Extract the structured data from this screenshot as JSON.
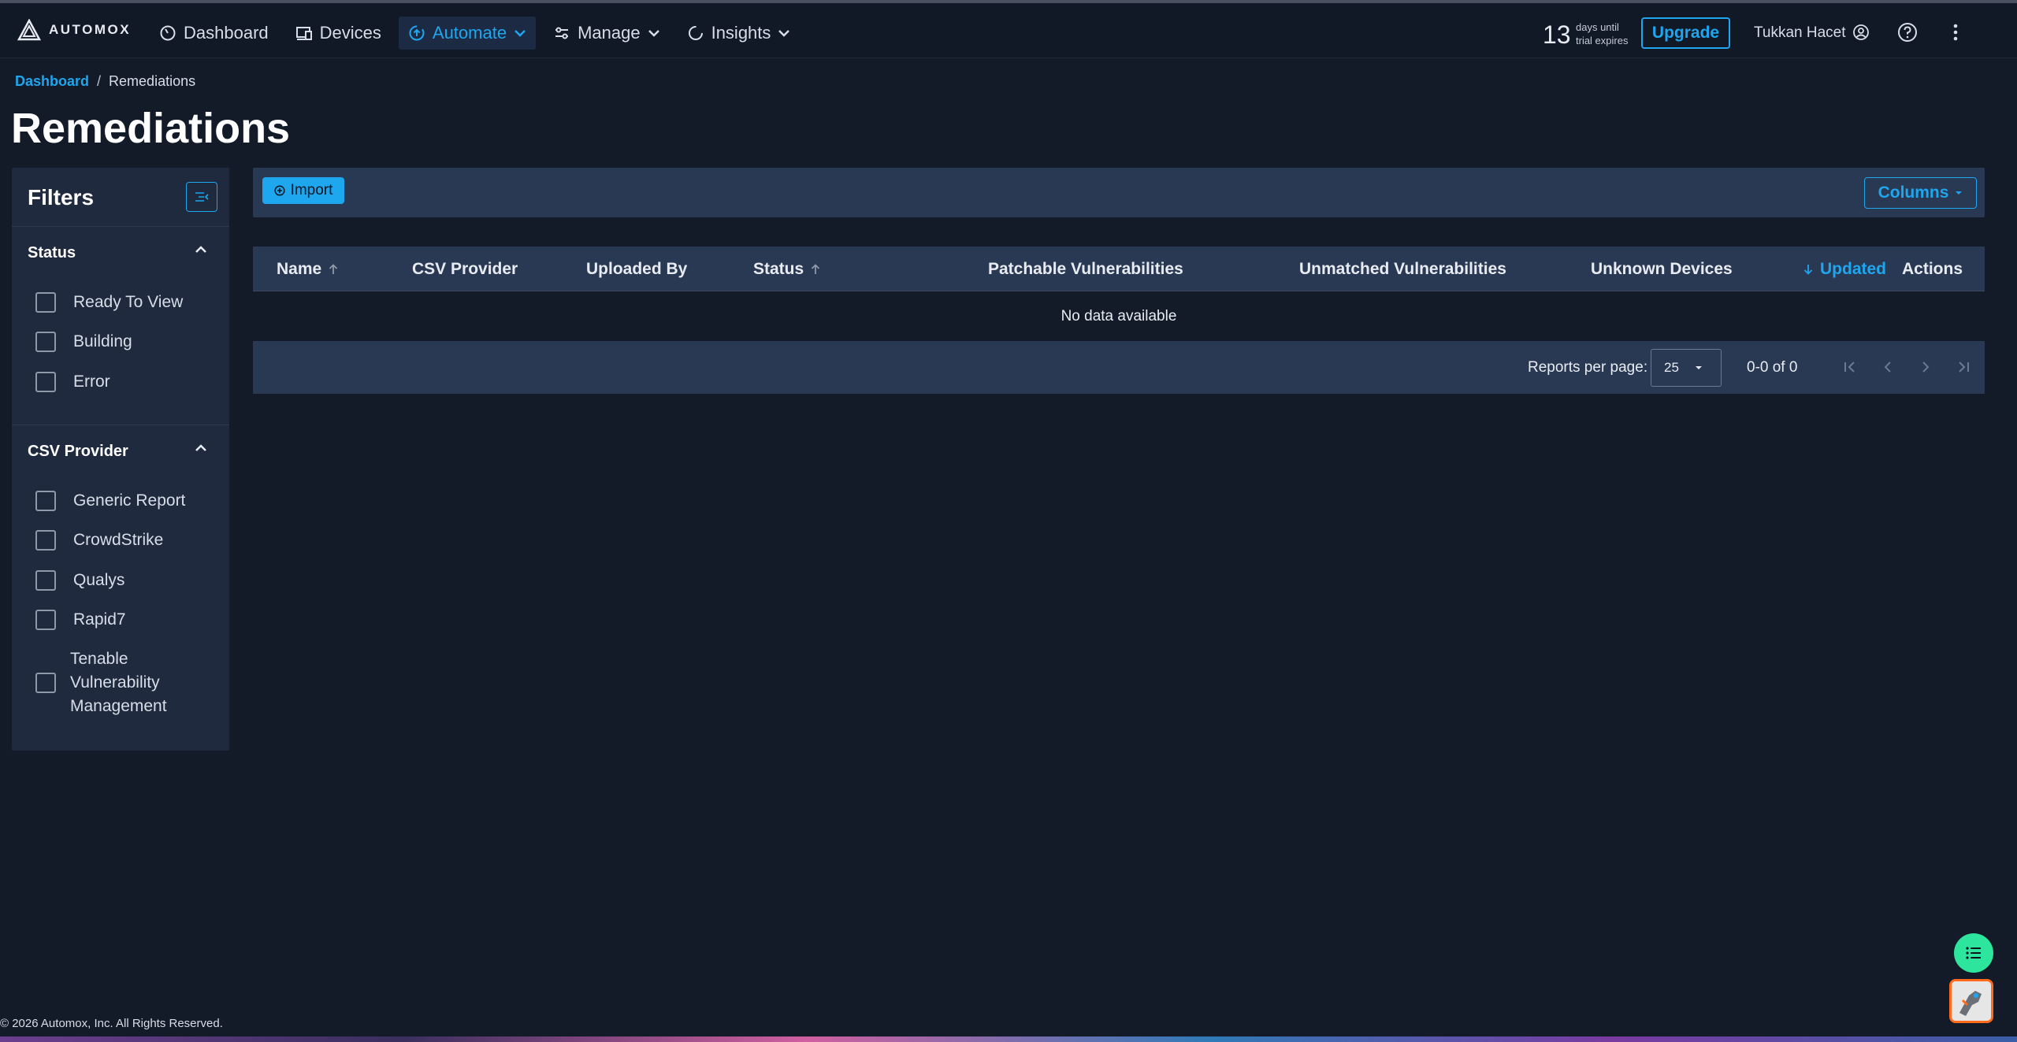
{
  "app": {
    "brand": "AUTOMOX",
    "accent_color": "#1ea6ee"
  },
  "nav": {
    "items": [
      {
        "label": "Dashboard",
        "icon": "gauge-icon"
      },
      {
        "label": "Devices",
        "icon": "devices-icon"
      },
      {
        "label": "Automate",
        "icon": "automate-icon",
        "active": true
      },
      {
        "label": "Manage",
        "icon": "sliders-icon"
      },
      {
        "label": "Insights",
        "icon": "insights-icon"
      }
    ]
  },
  "trial": {
    "days": "13",
    "line1": "days until",
    "line2": "trial expires"
  },
  "header": {
    "upgrade_label": "Upgrade",
    "user_name": "Tukkan Hacet"
  },
  "breadcrumb": {
    "root": "Dashboard",
    "sep": "/",
    "current": "Remediations"
  },
  "page": {
    "title": "Remediations"
  },
  "filters": {
    "title": "Filters",
    "status": {
      "title": "Status",
      "options": [
        "Ready To View",
        "Building",
        "Error"
      ]
    },
    "csv_provider": {
      "title": "CSV Provider",
      "options": [
        "Generic Report",
        "CrowdStrike",
        "Qualys",
        "Rapid7"
      ],
      "multiline_option": [
        "Tenable",
        "Vulnerability",
        "Management"
      ]
    }
  },
  "toolbar": {
    "import_label": "Import",
    "columns_label": "Columns"
  },
  "table": {
    "columns": [
      "Name",
      "CSV Provider",
      "Uploaded By",
      "Status",
      "Patchable Vulnerabilities",
      "Unmatched Vulnerabilities",
      "Unknown Devices",
      "Updated",
      "Actions"
    ],
    "empty_text": "No data available",
    "rows_per_page_label": "Reports per page:",
    "rows_per_page_value": "25",
    "page_range": "0-0 of 0"
  },
  "footer": {
    "copyright": "© 2026 Automox, Inc. All Rights Reserved."
  }
}
